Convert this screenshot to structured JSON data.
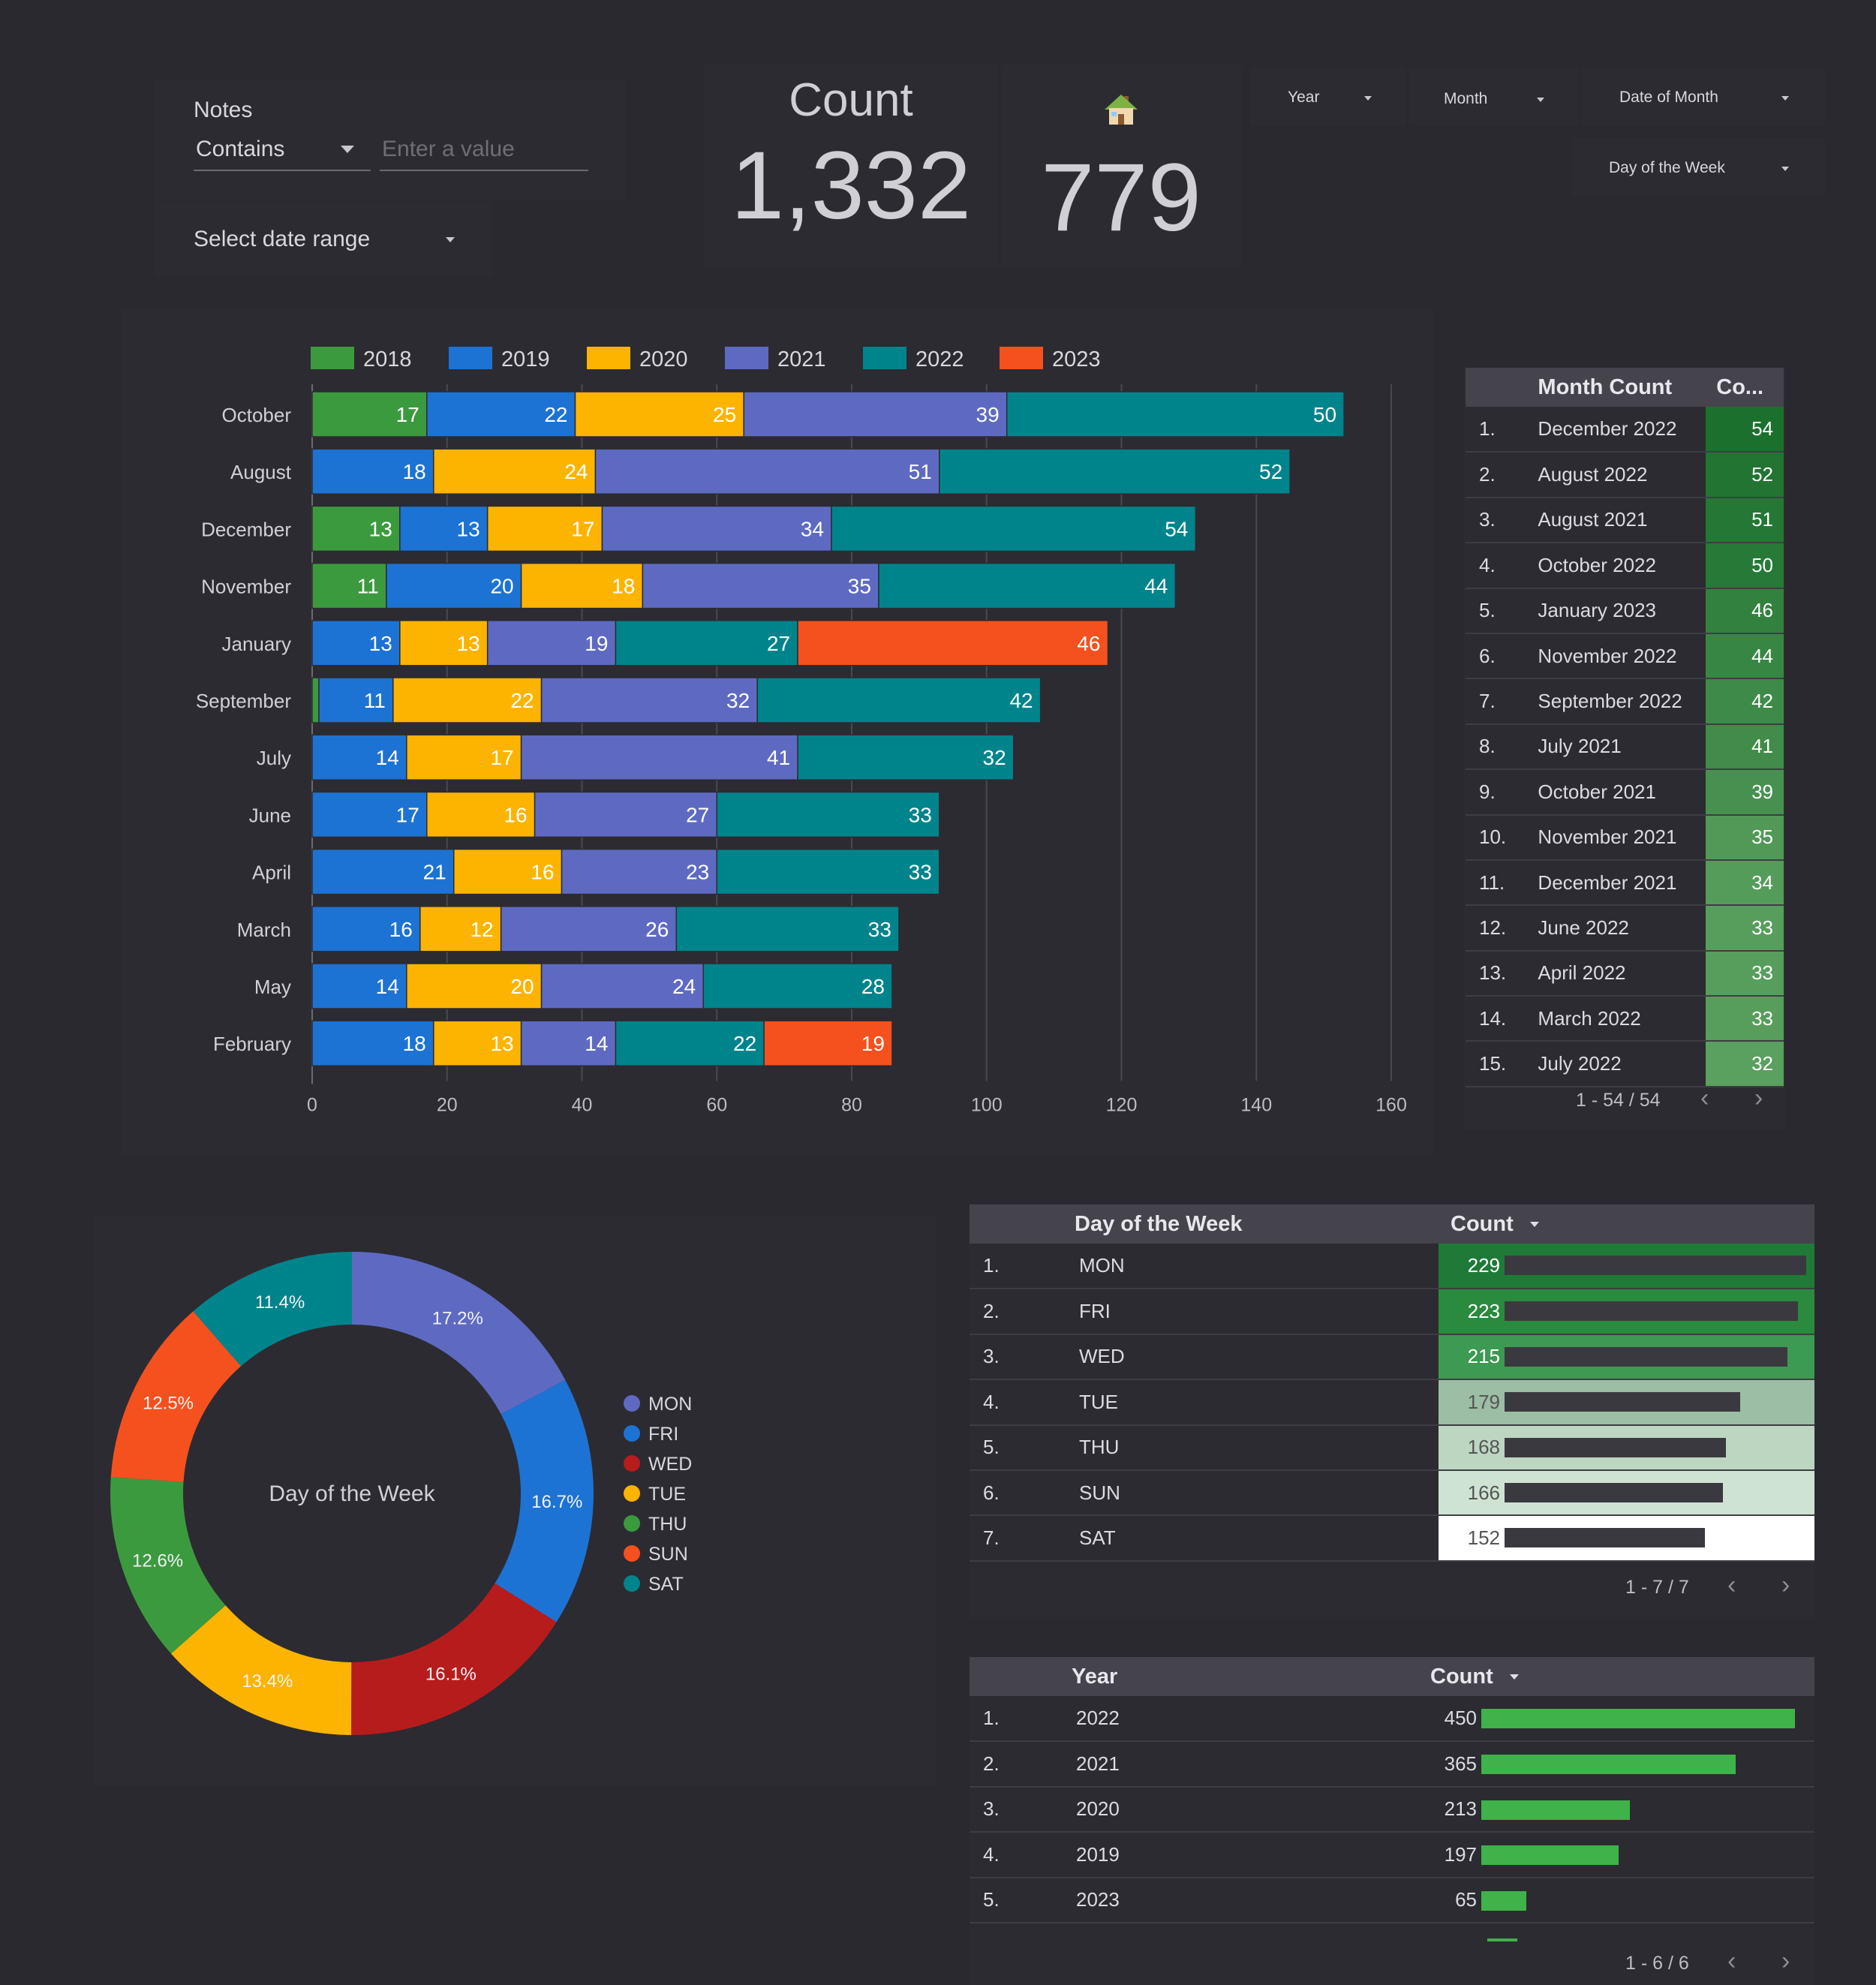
{
  "filters": {
    "notes_label": "Notes",
    "operator_value": "Contains",
    "value_placeholder": "Enter a value",
    "date_range_label": "Select date range",
    "dropdowns": [
      "Year",
      "Month",
      "Date of Month",
      "Day of the Week"
    ]
  },
  "scorecards": {
    "count_label": "Count",
    "count_value": "1,332",
    "home_icon": "house-icon",
    "home_value": "779"
  },
  "colors": {
    "2018": "#3c9a3e",
    "2019": "#1d73d3",
    "2020": "#fdb400",
    "2021": "#5e6ac2",
    "2022": "#00848c",
    "2023": "#f4511e"
  },
  "chart_data": [
    {
      "type": "bar",
      "orientation": "horizontal-stacked",
      "categories": [
        "October",
        "August",
        "December",
        "November",
        "January",
        "September",
        "July",
        "June",
        "April",
        "March",
        "May",
        "February"
      ],
      "series": [
        {
          "name": "2018",
          "values": [
            17,
            0,
            13,
            11,
            0,
            1,
            0,
            0,
            0,
            0,
            0,
            0
          ]
        },
        {
          "name": "2019",
          "values": [
            22,
            18,
            13,
            20,
            13,
            11,
            14,
            17,
            21,
            16,
            14,
            18
          ]
        },
        {
          "name": "2020",
          "values": [
            25,
            24,
            17,
            18,
            13,
            22,
            17,
            16,
            16,
            12,
            20,
            13
          ]
        },
        {
          "name": "2021",
          "values": [
            39,
            51,
            34,
            35,
            19,
            32,
            41,
            27,
            23,
            26,
            24,
            14
          ]
        },
        {
          "name": "2022",
          "values": [
            50,
            52,
            54,
            44,
            27,
            42,
            32,
            33,
            33,
            33,
            28,
            22
          ]
        },
        {
          "name": "2023",
          "values": [
            0,
            0,
            0,
            0,
            46,
            0,
            0,
            0,
            0,
            0,
            0,
            19
          ]
        }
      ],
      "xticks": [
        0,
        20,
        40,
        60,
        80,
        100,
        120,
        140,
        160
      ],
      "xlim": [
        0,
        160
      ],
      "grid": true,
      "legend": "top"
    },
    {
      "type": "pie",
      "variant": "donut",
      "center_label": "Day of the Week",
      "labels": [
        "MON",
        "FRI",
        "WED",
        "TUE",
        "THU",
        "SUN",
        "SAT"
      ],
      "values": [
        17.2,
        16.7,
        16.1,
        13.4,
        12.6,
        12.5,
        11.4
      ],
      "colors": [
        "#5e6ac2",
        "#1d73d3",
        "#b71c1c",
        "#fdb400",
        "#3c9a3e",
        "#f4511e",
        "#00848c"
      ],
      "legend": "right"
    },
    {
      "type": "table",
      "headers": [
        "Month Count",
        "Co..."
      ],
      "rows": [
        {
          "rank": "1.",
          "label": "December 2022",
          "value": 54
        },
        {
          "rank": "2.",
          "label": "August 2022",
          "value": 52
        },
        {
          "rank": "3.",
          "label": "August 2021",
          "value": 51
        },
        {
          "rank": "4.",
          "label": "October 2022",
          "value": 50
        },
        {
          "rank": "5.",
          "label": "January 2023",
          "value": 46
        },
        {
          "rank": "6.",
          "label": "November 2022",
          "value": 44
        },
        {
          "rank": "7.",
          "label": "September 2022",
          "value": 42
        },
        {
          "rank": "8.",
          "label": "July 2021",
          "value": 41
        },
        {
          "rank": "9.",
          "label": "October 2021",
          "value": 39
        },
        {
          "rank": "10.",
          "label": "November 2021",
          "value": 35
        },
        {
          "rank": "11.",
          "label": "December 2021",
          "value": 34
        },
        {
          "rank": "12.",
          "label": "June 2022",
          "value": 33
        },
        {
          "rank": "13.",
          "label": "April 2022",
          "value": 33
        },
        {
          "rank": "14.",
          "label": "March 2022",
          "value": 33
        },
        {
          "rank": "15.",
          "label": "July 2022",
          "value": 32
        }
      ],
      "pager": "1 - 54 / 54"
    },
    {
      "type": "table",
      "headers": [
        "Day of the Week",
        "Count"
      ],
      "rows": [
        {
          "rank": "1.",
          "label": "MON",
          "value": 229
        },
        {
          "rank": "2.",
          "label": "FRI",
          "value": 223
        },
        {
          "rank": "3.",
          "label": "WED",
          "value": 215
        },
        {
          "rank": "4.",
          "label": "TUE",
          "value": 179
        },
        {
          "rank": "5.",
          "label": "THU",
          "value": 168
        },
        {
          "rank": "6.",
          "label": "SUN",
          "value": 166
        },
        {
          "rank": "7.",
          "label": "SAT",
          "value": 152
        }
      ],
      "pager": "1 - 7 / 7"
    },
    {
      "type": "table",
      "headers": [
        "Year",
        "Count"
      ],
      "rows": [
        {
          "rank": "1.",
          "label": "2022",
          "value": 450
        },
        {
          "rank": "2.",
          "label": "2021",
          "value": 365
        },
        {
          "rank": "3.",
          "label": "2020",
          "value": 213
        },
        {
          "rank": "4.",
          "label": "2019",
          "value": 197
        },
        {
          "rank": "5.",
          "label": "2023",
          "value": 65
        }
      ],
      "pager": "1 - 6 / 6"
    }
  ]
}
